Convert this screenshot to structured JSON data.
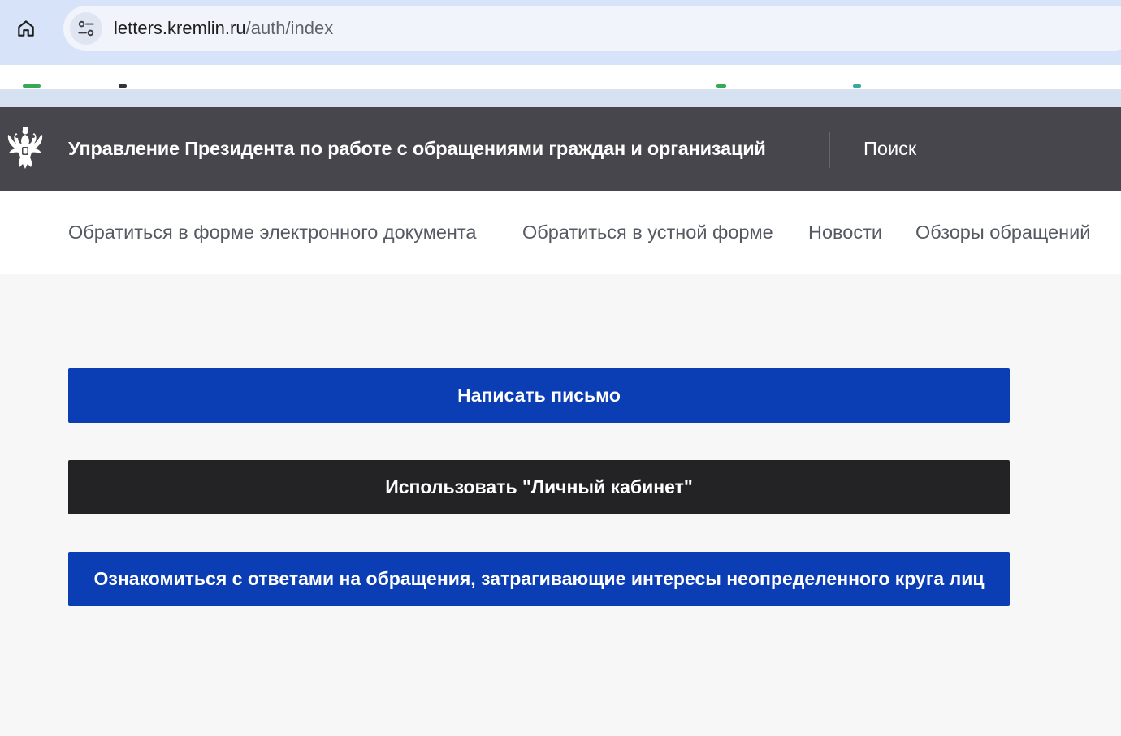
{
  "browser": {
    "url_host": "letters.kremlin.ru",
    "url_path": "/auth/index",
    "icons": [
      "home-icon",
      "site-info-icon"
    ]
  },
  "header": {
    "title": "Управление Президента по работе с обращениями граждан и организаций",
    "search_label": "Поиск",
    "logo_icon": "double-headed-eagle-emblem"
  },
  "nav": {
    "items": [
      {
        "label": "Обратиться в форме электронного документа"
      },
      {
        "label": "Обратиться в устной форме"
      },
      {
        "label": "Новости"
      },
      {
        "label": "Обзоры обращений"
      }
    ]
  },
  "actions": {
    "write_letter": "Написать письмо",
    "personal_account": "Использовать \"Личный кабинет\"",
    "view_answers": "Ознакомиться с ответами на обращения, затрагивающие интересы неопределенного круга лиц"
  },
  "colors": {
    "header_bg": "#46464c",
    "primary_blue": "#0b3db5",
    "dark_button": "#232325",
    "page_bg": "#f7f7f8"
  }
}
